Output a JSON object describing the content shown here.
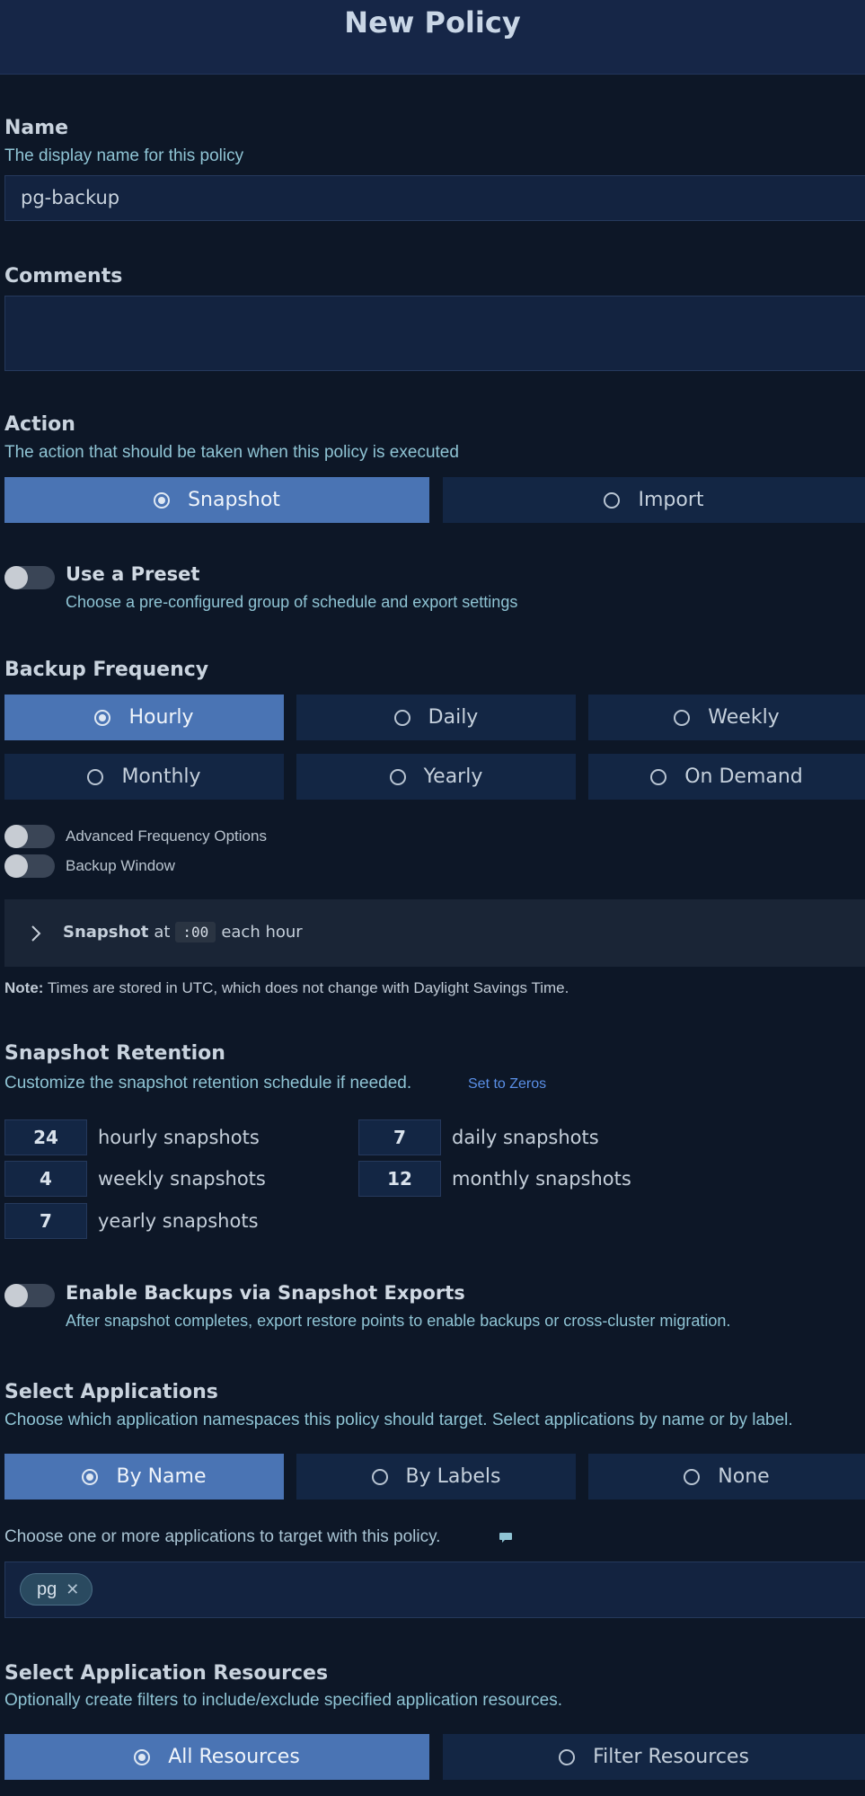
{
  "header": {
    "title": "New Policy"
  },
  "name": {
    "label": "Name",
    "help": "The display name for this policy",
    "value": "pg-backup"
  },
  "comments": {
    "label": "Comments",
    "value": ""
  },
  "action": {
    "label": "Action",
    "help": "The action that should be taken when this policy is executed",
    "options": [
      {
        "label": "Snapshot",
        "selected": true
      },
      {
        "label": "Import",
        "selected": false
      }
    ]
  },
  "preset": {
    "label": "Use a Preset",
    "help": "Choose a pre-configured group of schedule and export settings",
    "enabled": false
  },
  "frequency": {
    "label": "Backup Frequency",
    "options": [
      {
        "label": "Hourly",
        "selected": true
      },
      {
        "label": "Daily",
        "selected": false
      },
      {
        "label": "Weekly",
        "selected": false
      },
      {
        "label": "Monthly",
        "selected": false
      },
      {
        "label": "Yearly",
        "selected": false
      },
      {
        "label": "On Demand",
        "selected": false
      }
    ],
    "advanced_label": "Advanced Frequency Options",
    "window_label": "Backup Window"
  },
  "schedule": {
    "strong": "Snapshot",
    "at": "at",
    "minute": ":00",
    "suffix": "each hour"
  },
  "note": {
    "strong": "Note:",
    "text": "Times are stored in UTC, which does not change with Daylight Savings Time."
  },
  "retention": {
    "label": "Snapshot Retention",
    "help": "Customize the snapshot retention schedule if needed.",
    "link": "Set to Zeros",
    "items": [
      {
        "value": "24",
        "label": "hourly snapshots"
      },
      {
        "value": "7",
        "label": "daily snapshots"
      },
      {
        "value": "4",
        "label": "weekly snapshots"
      },
      {
        "value": "12",
        "label": "monthly snapshots"
      },
      {
        "value": "7",
        "label": "yearly snapshots"
      }
    ]
  },
  "exports": {
    "label": "Enable Backups via Snapshot Exports",
    "help": "After snapshot completes, export restore points to enable backups or cross-cluster migration.",
    "enabled": false
  },
  "applications": {
    "label": "Select Applications",
    "help": "Choose which application namespaces this policy should target. Select applications by name or by label.",
    "options": [
      {
        "label": "By Name",
        "selected": true
      },
      {
        "label": "By Labels",
        "selected": false
      },
      {
        "label": "None",
        "selected": false
      }
    ],
    "choose_text": "Choose one or more applications to target with this policy.",
    "chips": [
      "pg"
    ],
    "chip_remove": "✕"
  },
  "resources": {
    "label": "Select Application Resources",
    "help": "Optionally create filters to include/exclude specified application resources.",
    "options": [
      {
        "label": "All Resources",
        "selected": true
      },
      {
        "label": "Filter Resources",
        "selected": false
      }
    ]
  },
  "colors": {
    "background": "#0d1727",
    "header": "#162647",
    "accent": "#4a74b4",
    "help_text": "#8fc4d4",
    "link": "#5a8fe6"
  }
}
